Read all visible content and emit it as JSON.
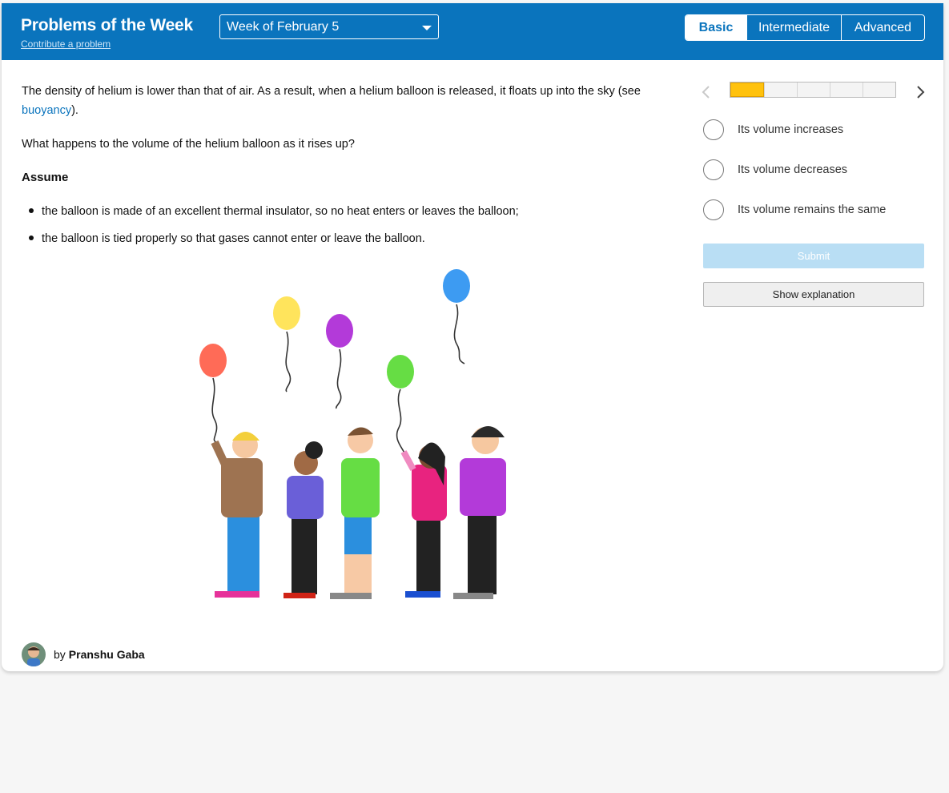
{
  "header": {
    "title": "Problems of the Week",
    "contribute_link": "Contribute a problem",
    "week_selector": "Week of February 5",
    "levels": [
      "Basic",
      "Intermediate",
      "Advanced"
    ],
    "active_level": "Basic",
    "brand_color": "#0a74bd"
  },
  "problem": {
    "intro_before_link": "The density of helium is lower than that of air. As a result, when a helium balloon is released, it floats up into the sky (see ",
    "intro_link": "buoyancy",
    "intro_after_link": ").",
    "question": "What happens to the volume of the helium balloon as it rises up?",
    "assume_heading": "Assume",
    "assumptions": [
      "the balloon is made of an excellent thermal insulator, so no heat enters or leaves the balloon;",
      "the balloon is tied properly so that gases cannot enter or leave the balloon."
    ]
  },
  "author": {
    "prefix": "by",
    "name": "Pranshu Gaba"
  },
  "answer_panel": {
    "progress_segments": 5,
    "progress_filled": 1,
    "options": [
      "Its volume increases",
      "Its volume decreases",
      "Its volume remains the same"
    ],
    "submit_label": "Submit",
    "explanation_label": "Show explanation",
    "progress_color": "#ffc20e"
  },
  "illustration": {
    "balloon_colors": [
      "#ff6b57",
      "#ffe45c",
      "#b33ad9",
      "#66dd44",
      "#3d9bf2"
    ]
  }
}
